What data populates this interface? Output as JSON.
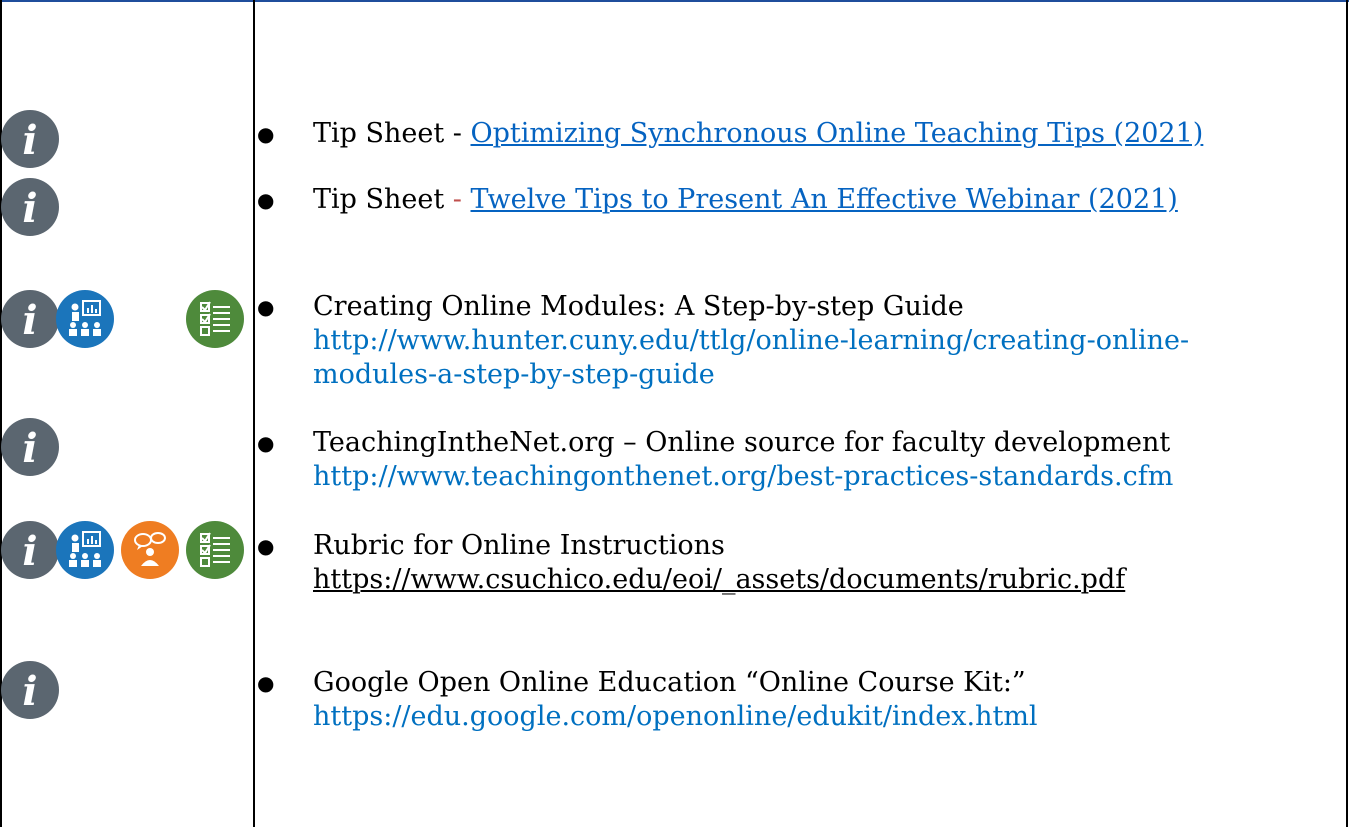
{
  "items": [
    {
      "label": "Tip Sheet - ",
      "link": "Optimizing Synchronous Online Teaching Tips (2021)",
      "icons": [
        "info-icon"
      ]
    },
    {
      "label": "Tip Sheet ",
      "separator": "-",
      "link": "Twelve Tips to Present An Effective Webinar (2021)",
      "icons": [
        "info-icon"
      ]
    },
    {
      "label": "Creating Online Modules: A Step-by-step Guide",
      "url_line1": "http://www.hunter.cuny.edu/ttlg/online-learning/creating-online-",
      "url_line2": "modules-a-step-by-step-guide",
      "icons": [
        "info-icon",
        "presentation-icon",
        "checklist-icon"
      ]
    },
    {
      "label": "TeachingIntheNet.org – Online source for faculty development",
      "url": "http://www.teachingonthenet.org/best-practices-standards.cfm",
      "icons": [
        "info-icon"
      ]
    },
    {
      "label": "Rubric for Online Instructions",
      "url": "https://www.csuchico.edu/eoi/_assets/documents/rubric.pdf",
      "icons": [
        "info-icon",
        "presentation-icon",
        "discussion-icon",
        "checklist-icon"
      ]
    },
    {
      "label": "Google Open Online Education “Online Course Kit:”",
      "url": "https://edu.google.com/openonline/edukit/index.html",
      "icons": [
        "info-icon"
      ]
    }
  ],
  "colors": {
    "info": "#5b6670",
    "presentation": "#1b75bb",
    "discussion": "#ef7d22",
    "checklist": "#4e8a3b",
    "link": "#0563c1",
    "url": "#0070c0",
    "frame_top": "#1f4e9c"
  }
}
